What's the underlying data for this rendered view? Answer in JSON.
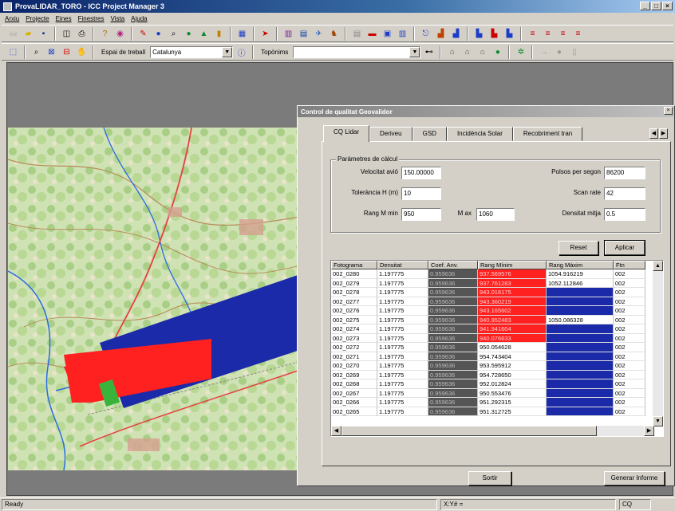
{
  "window": {
    "title": "ProvaLIDAR_TORO - ICC Project Manager 3",
    "buttons": [
      "_",
      "□",
      "×"
    ]
  },
  "menu": [
    "Arxiu",
    "Projecte",
    "Eines",
    "Finestres",
    "Vista",
    "Ajuda"
  ],
  "toolbar2": {
    "workspace_label": "Espai de treball",
    "workspace_value": "Catalunya",
    "toponym_label": "Topònims",
    "toponym_value": ""
  },
  "dialog": {
    "title": "Control de qualitat Geovalidor",
    "close": "×",
    "tabs": [
      {
        "label": "CQ Lidar",
        "active": true
      },
      {
        "label": "Deriveu",
        "active": false
      },
      {
        "label": "GSD",
        "active": false
      },
      {
        "label": "Incidència Solar",
        "active": false
      },
      {
        "label": "Recobriment tran",
        "active": false
      }
    ],
    "params": {
      "group_title": "Paràmetres de càlcul",
      "velocitat_label": "Velocitat avió",
      "velocitat_value": "150.00000",
      "polsos_label": "Polsos per segon",
      "polsos_value": "86200",
      "tolerancia_label": "Tolerància H (m)",
      "tolerancia_value": "10",
      "scan_label": "Scan rate",
      "scan_value": "42",
      "rang_min_label": "Rang M min",
      "rang_min_value": "950",
      "max_label": "M ax",
      "max_value": "1060",
      "densitat_label": "Densitat mitja",
      "densitat_value": "0.5"
    },
    "buttons": {
      "reset": "Reset",
      "aplicar": "Aplicar",
      "sortir": "Sortir",
      "informe": "Generar Informe"
    },
    "grid": {
      "columns": [
        "Fotograma",
        "Densitat",
        "Coef. Anv.",
        "Rang Mínim",
        "Rang Màxim",
        "Ftn"
      ],
      "rows": [
        [
          "002_0280",
          "1.197775",
          "0.959636",
          "937.569576",
          "1054.916219",
          "002"
        ],
        [
          "002_0279",
          "1.197775",
          "0.959636",
          "937.761283",
          "1052.112846",
          "002"
        ],
        [
          "002_0278",
          "1.197775",
          "0.959636",
          "943.016175",
          "",
          "002"
        ],
        [
          "002_0277",
          "1.197775",
          "0.959636",
          "943.360219",
          "",
          "002"
        ],
        [
          "002_0276",
          "1.197775",
          "0.959636",
          "943.165602",
          "",
          "002"
        ],
        [
          "002_0275",
          "1.197775",
          "0.959636",
          "940.952483",
          "1050.086328",
          "002"
        ],
        [
          "002_0274",
          "1.197775",
          "0.959636",
          "941.941604",
          "",
          "002"
        ],
        [
          "002_0273",
          "1.197775",
          "0.959636",
          "940.076633",
          "",
          "002"
        ],
        [
          "002_0272",
          "1.197775",
          "0.959636",
          "950.054628",
          "",
          "002"
        ],
        [
          "002_0271",
          "1.197775",
          "0.959636",
          "954.743404",
          "",
          "002"
        ],
        [
          "002_0270",
          "1.197775",
          "0.959636",
          "953.595912",
          "",
          "002"
        ],
        [
          "002_0269",
          "1.197775",
          "0.959636",
          "954.728650",
          "",
          "002"
        ],
        [
          "002_0268",
          "1.197775",
          "0.959636",
          "952.012824",
          "",
          "002"
        ],
        [
          "002_0267",
          "1.197775",
          "0.959636",
          "950.553476",
          "",
          "002"
        ],
        [
          "002_0266",
          "1.197775",
          "0.959636",
          "951.292315",
          "",
          "002"
        ],
        [
          "002_0265",
          "1.197775",
          "0.959636",
          "951.312725",
          "",
          "002"
        ]
      ],
      "min_flags": [
        1,
        1,
        1,
        1,
        1,
        1,
        1,
        1,
        0,
        0,
        0,
        0,
        0,
        0,
        0,
        0
      ],
      "max_flags": [
        0,
        0,
        1,
        1,
        1,
        0,
        1,
        1,
        1,
        1,
        1,
        1,
        1,
        1,
        1,
        1
      ]
    }
  },
  "status": {
    "left": "Ready",
    "coords": "X:Y# = ",
    "right": "CQ"
  },
  "colors": {
    "alarm_red": "#ff2020",
    "alarm_blue": "#1a2aa8",
    "coef_dark": "#555555",
    "title_blue": "#0a246a"
  }
}
